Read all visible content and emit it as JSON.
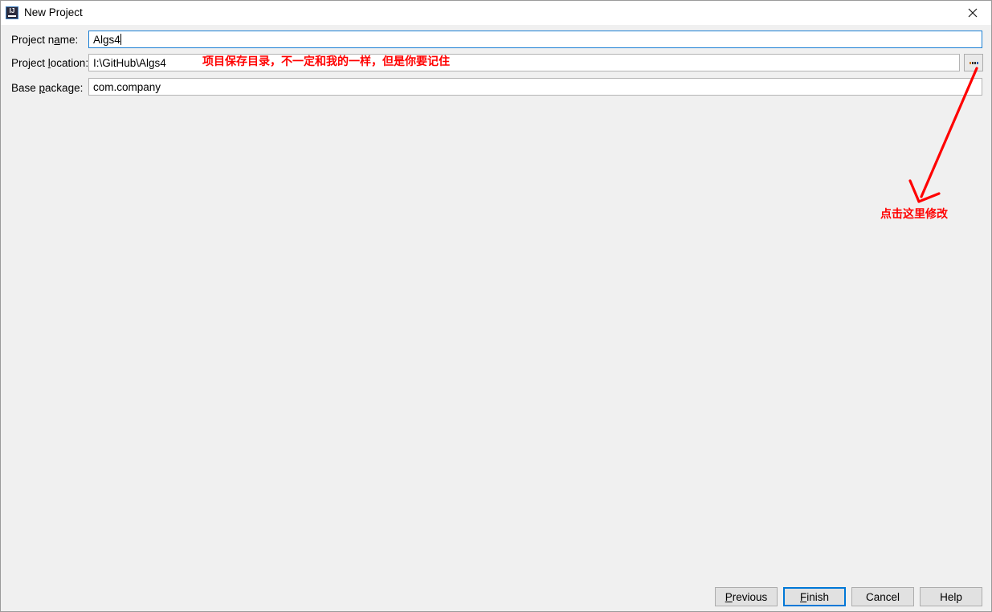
{
  "window": {
    "title": "New Project",
    "icon": "intellij-idea-icon",
    "icon_letters": "IJ",
    "close_icon": "close-icon"
  },
  "form": {
    "rows": [
      {
        "label_prefix": "Project n",
        "label_mnemonic": "a",
        "label_suffix": "me:",
        "value": "Algs4",
        "focused": true
      },
      {
        "label_prefix": "Project ",
        "label_mnemonic": "l",
        "label_suffix": "ocation:",
        "value": "I:\\GitHub\\Algs4",
        "focused": false
      },
      {
        "label_prefix": "Base ",
        "label_mnemonic": "p",
        "label_suffix": "ackage:",
        "value": "com.company",
        "focused": false
      }
    ],
    "browse_button": {
      "name": "browse-ellipsis-button",
      "label": "..."
    }
  },
  "annotations": {
    "location_note": "项目保存目录，不一定和我的一样，但是你要记住",
    "browse_note": "点击这里修改",
    "arrow_color": "#ff0000"
  },
  "footer": {
    "buttons": [
      {
        "prefix": "",
        "mnemonic": "P",
        "suffix": "revious",
        "default": false,
        "name": "previous-button"
      },
      {
        "prefix": "",
        "mnemonic": "F",
        "suffix": "inish",
        "default": true,
        "name": "finish-button"
      },
      {
        "prefix": "Cancel",
        "mnemonic": "",
        "suffix": "",
        "default": false,
        "name": "cancel-button"
      },
      {
        "prefix": "Help",
        "mnemonic": "",
        "suffix": "",
        "default": false,
        "name": "help-button"
      }
    ]
  },
  "colors": {
    "dialog_bg": "#f0f0f0",
    "titlebar_bg": "#ffffff",
    "field_border": "#b4b4b4",
    "focus_border": "#1a7fd4",
    "default_button_border": "#0078d7",
    "annotation_red": "#ff0000"
  }
}
